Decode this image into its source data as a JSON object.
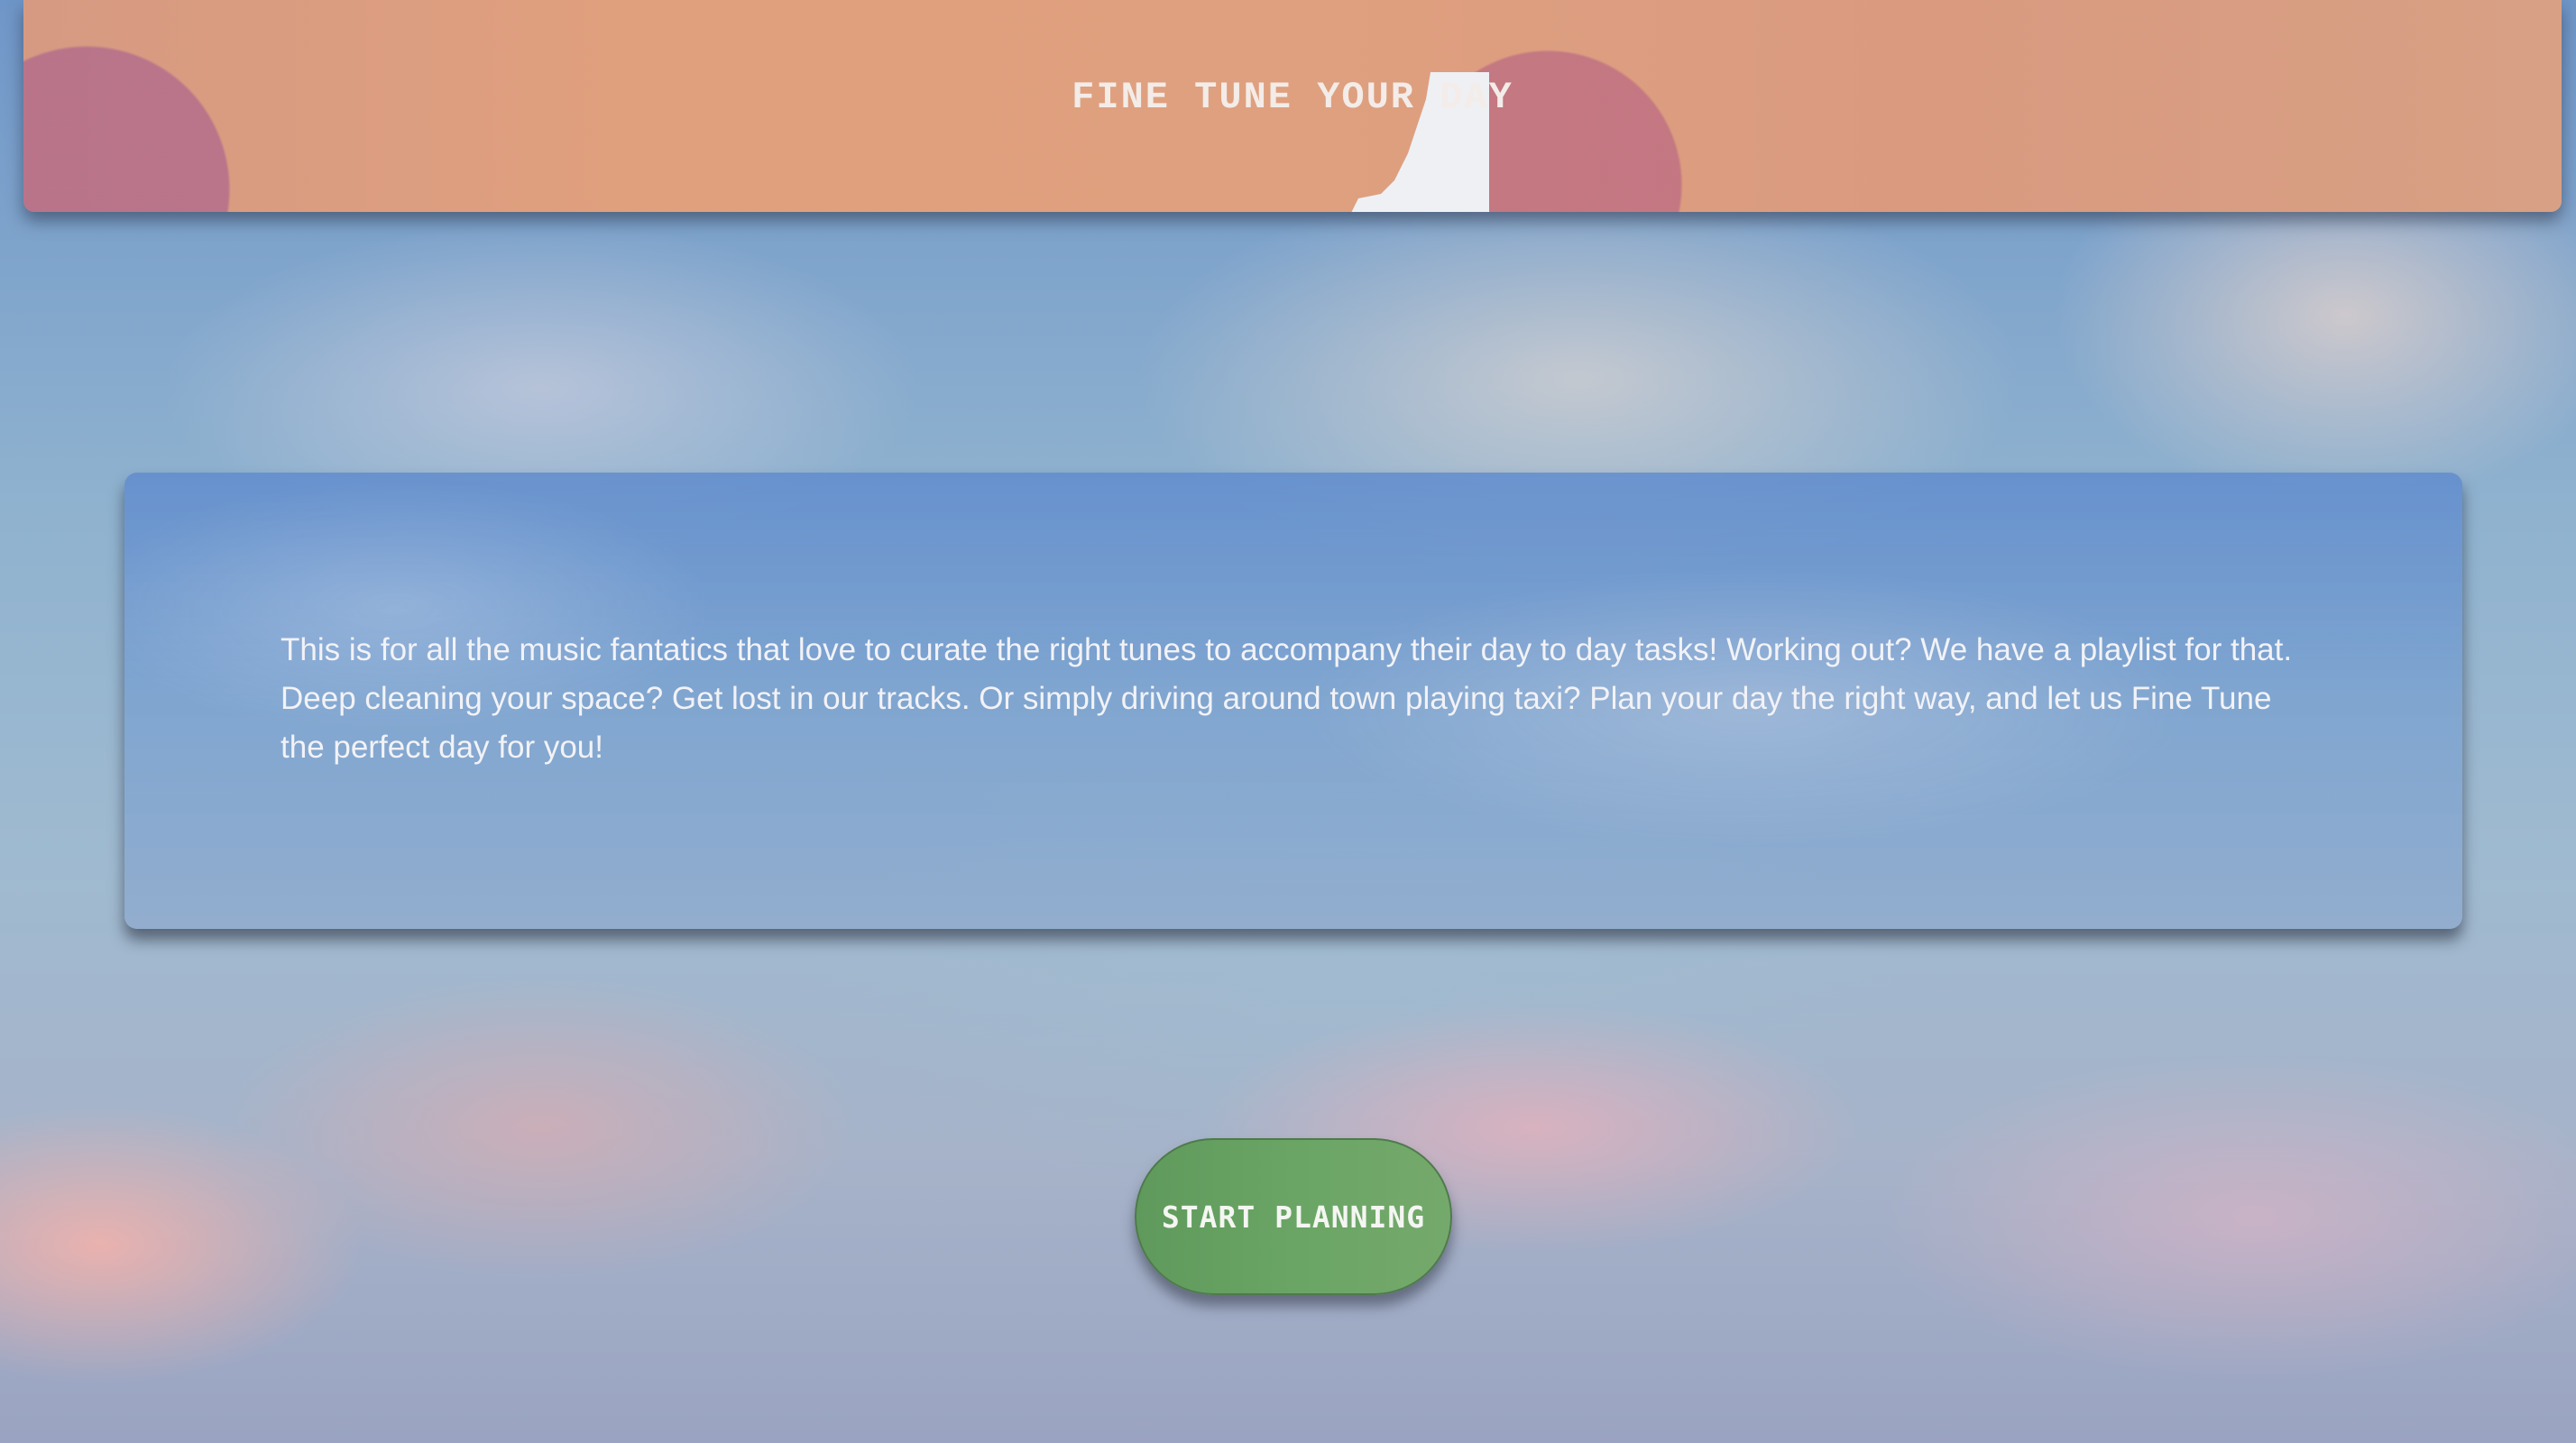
{
  "header": {
    "title": "FINE TUNE YOUR DAY"
  },
  "intro": {
    "text": "This is for all the music fantatics that love to curate the right tunes to accompany their day to day tasks! Working out? We have a playlist for that. Deep cleaning your space? Get lost in our tracks. Or simply driving around town playing taxi? Plan your day the right way, and let us Fine Tune the perfect day for you!"
  },
  "cta": {
    "label": "START PLANNING"
  },
  "colors": {
    "header_bg": "#e0a07e",
    "card_bg": "#7aa0d0",
    "button_bg": "#6aa565",
    "text": "#f2f2f6"
  }
}
